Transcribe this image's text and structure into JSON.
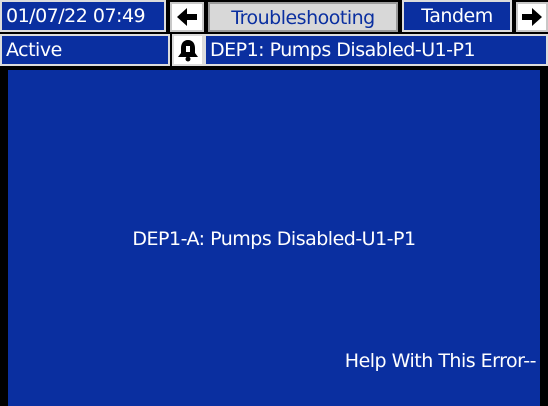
{
  "header": {
    "datetime": "01/07/22 07:49",
    "active_tab": "Troubleshooting",
    "next_tab": "Tandem"
  },
  "status_bar": {
    "state": "Active",
    "error_code": "DEP1: Pumps Disabled-U1-P1"
  },
  "main": {
    "message": "DEP1-A: Pumps Disabled-U1-P1",
    "help_link": "Help With This Error--"
  },
  "icons": {
    "left": "arrow-left-icon",
    "right": "arrow-right-icon",
    "alarm": "bell-icon"
  },
  "colors": {
    "panel": "#0a2fa0",
    "background": "#000000",
    "tab_active": "#d8d8d8"
  }
}
